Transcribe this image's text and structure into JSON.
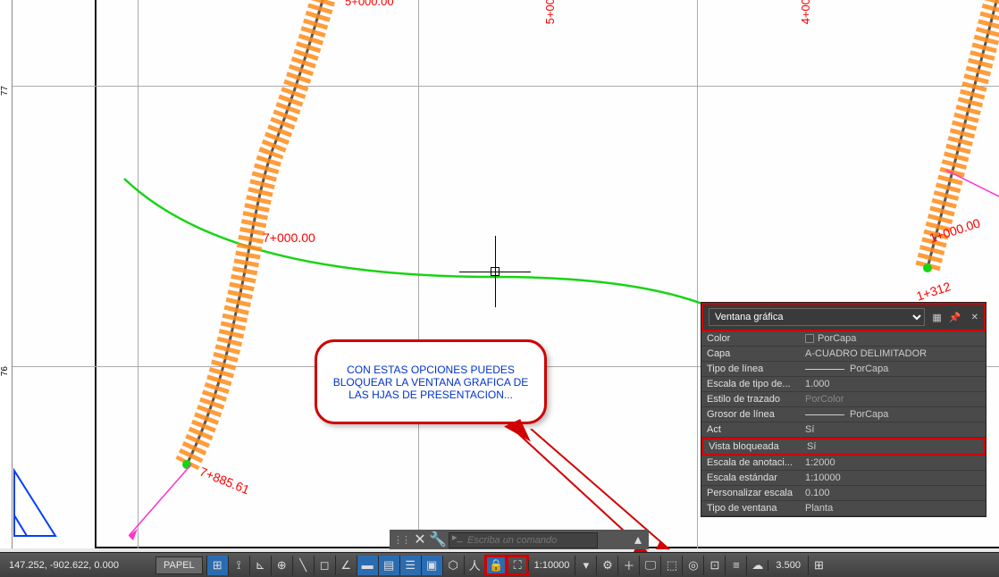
{
  "axis_labels": {
    "top_left": "5+000.00",
    "top_mid": "5+00",
    "top_right": "4+00"
  },
  "ruler": {
    "t1": "77",
    "t2": "76"
  },
  "stations": {
    "s1": "7+000.00",
    "s2": "7+885.61",
    "s3": "1+000.00",
    "s4": "1+312"
  },
  "callout_text": "CON ESTAS OPCIONES PUEDES BLOQUEAR LA VENTANA GRAFICA DE LAS HJAS DE PRESENTACION...",
  "properties": {
    "title": "Ventana gráfica",
    "rows": [
      {
        "label": "Color",
        "value": "PorCapa",
        "swatch": true
      },
      {
        "label": "Capa",
        "value": "A-CUADRO DELIMITADOR"
      },
      {
        "label": "Tipo de línea",
        "value": "PorCapa",
        "line": true
      },
      {
        "label": "Escala de tipo de...",
        "value": "1.000"
      },
      {
        "label": "Estilo de trazado",
        "value": "PorColor",
        "muted": true
      },
      {
        "label": "Grosor de línea",
        "value": "PorCapa",
        "line": true
      },
      {
        "label": "Act",
        "value": "Sí"
      },
      {
        "label": "Vista bloqueada",
        "value": "Sí",
        "highlight": true
      },
      {
        "label": "Escala de anotaci...",
        "value": "1:2000"
      },
      {
        "label": "Escala estándar",
        "value": "1:10000"
      },
      {
        "label": "Personalizar escala",
        "value": "0.100"
      },
      {
        "label": "Tipo de ventana",
        "value": "Planta"
      }
    ]
  },
  "command": {
    "placeholder": "Escriba un comando"
  },
  "status": {
    "coords": "147.252, -902.622, 0.000",
    "space": "PAPEL",
    "scale": "1:10000",
    "elevation": "3.500"
  }
}
